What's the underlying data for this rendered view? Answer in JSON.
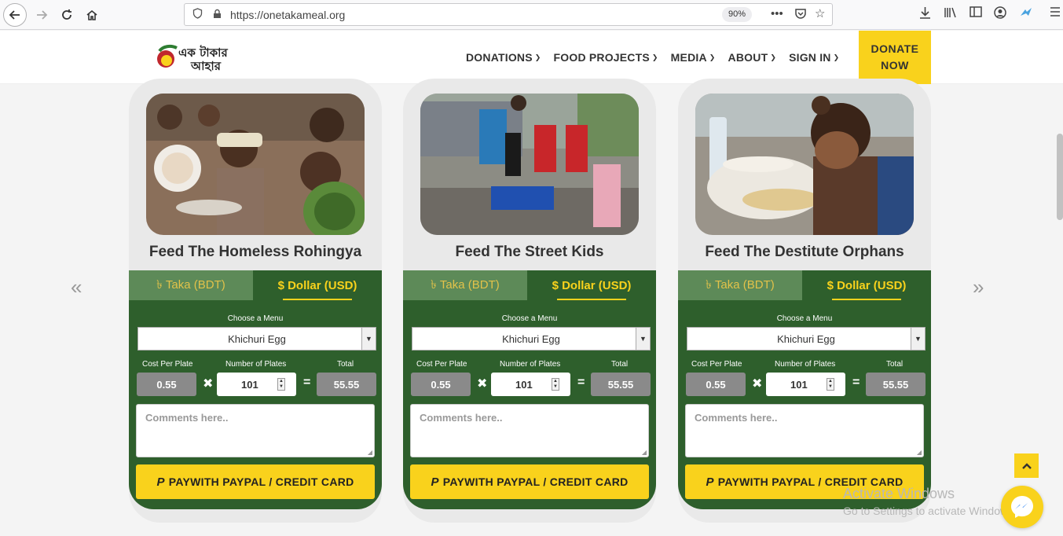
{
  "browser": {
    "url": "https://onetakameal.org",
    "zoom": "90%"
  },
  "site": {
    "logo_text_line1": "এক টাকার",
    "logo_text_line2": "আহার",
    "menu": [
      {
        "label": "DONATIONS"
      },
      {
        "label": "FOOD PROJECTS"
      },
      {
        "label": "MEDIA"
      },
      {
        "label": "ABOUT"
      },
      {
        "label": "SIGN IN"
      }
    ],
    "donate_line1": "DONATE",
    "donate_line2": "NOW"
  },
  "carousel": {
    "prev": "«",
    "next": "»",
    "cards": [
      {
        "title": "Feed The Homeless Rohingya",
        "tab_bdt": "৳ Taka (BDT)",
        "tab_usd": "$ Dollar (USD)",
        "menu_label": "Choose a Menu",
        "menu_value": "Khichuri Egg",
        "cost_label": "Cost Per Plate",
        "plates_label": "Number of Plates",
        "total_label": "Total",
        "cost": "0.55",
        "plates": "101",
        "total": "55.55",
        "comments_placeholder": "Comments here..",
        "pay_label": "PAYWITH PAYPAL / CREDIT CARD"
      },
      {
        "title": "Feed The Street Kids",
        "tab_bdt": "৳ Taka (BDT)",
        "tab_usd": "$ Dollar (USD)",
        "menu_label": "Choose a Menu",
        "menu_value": "Khichuri Egg",
        "cost_label": "Cost Per Plate",
        "plates_label": "Number of Plates",
        "total_label": "Total",
        "cost": "0.55",
        "plates": "101",
        "total": "55.55",
        "comments_placeholder": "Comments here..",
        "pay_label": "PAYWITH PAYPAL / CREDIT CARD"
      },
      {
        "title": "Feed The Destitute Orphans",
        "tab_bdt": "৳ Taka (BDT)",
        "tab_usd": "$ Dollar (USD)",
        "menu_label": "Choose a Menu",
        "menu_value": "Khichuri Egg",
        "cost_label": "Cost Per Plate",
        "plates_label": "Number of Plates",
        "total_label": "Total",
        "cost": "0.55",
        "plates": "101",
        "total": "55.55",
        "comments_placeholder": "Comments here..",
        "pay_label": "PAYWITH PAYPAL / CREDIT CARD"
      }
    ]
  },
  "watermark": {
    "line1": "Activate Windows",
    "line2": "Go to Settings to activate Windows."
  },
  "colors": {
    "accent_yellow": "#f9d21c",
    "panel_green": "#2e5f2c"
  }
}
